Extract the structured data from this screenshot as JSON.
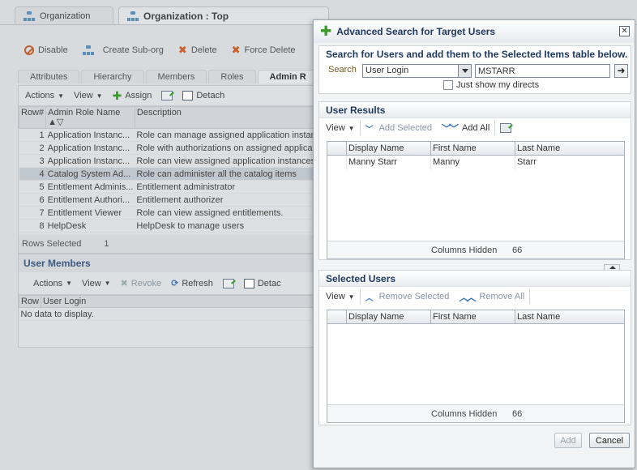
{
  "background": {
    "tabs": [
      {
        "label": "Organization"
      },
      {
        "label": "Organization : Top"
      }
    ],
    "toolbar": {
      "disable": "Disable",
      "create_suborg": "Create Sub-org",
      "delete": "Delete",
      "force_delete": "Force Delete"
    },
    "subtabs": [
      "Attributes",
      "Hierarchy",
      "Members",
      "Roles",
      "Admin R"
    ],
    "admin_roles": {
      "actions": "Actions",
      "view": "View",
      "assign": "Assign",
      "detach": "Detach",
      "columns": {
        "row": "Row#",
        "name": "Admin Role Name",
        "description": "Description"
      },
      "rows": [
        {
          "num": "1",
          "name": "Application Instanc...",
          "desc": "Role can manage assigned application instance"
        },
        {
          "num": "2",
          "name": "Application Instanc...",
          "desc": "Role with authorizations on assigned applicatio"
        },
        {
          "num": "3",
          "name": "Application Instanc...",
          "desc": "Role can view assigned application instances."
        },
        {
          "num": "4",
          "name": "Catalog System Ad...",
          "desc": "Role can administer all the catalog items"
        },
        {
          "num": "5",
          "name": "Entitlement Adminis...",
          "desc": "Entitlement administrator"
        },
        {
          "num": "6",
          "name": "Entitlement Authori...",
          "desc": "Entitlement authorizer"
        },
        {
          "num": "7",
          "name": "Entitlement Viewer",
          "desc": "Role can view assigned entitlements."
        },
        {
          "num": "8",
          "name": "HelpDesk",
          "desc": "HelpDesk to manage users"
        }
      ],
      "rows_selected_label": "Rows Selected",
      "rows_selected_value": "1"
    },
    "user_members": {
      "title": "User Members",
      "actions": "Actions",
      "view": "View",
      "revoke": "Revoke",
      "refresh": "Refresh",
      "detach": "Detac",
      "columns": {
        "row": "Row",
        "login": "User Login"
      },
      "empty": "No data to display."
    }
  },
  "dialog": {
    "title": "Advanced Search for Target Users",
    "search_heading": "Search for Users and add them to the Selected Items table below.",
    "search_label": "Search",
    "search_field": "User Login",
    "search_value": "MSTARR",
    "just_directs": "Just show my directs",
    "user_results": {
      "title": "User Results",
      "view": "View",
      "add_selected": "Add Selected",
      "add_all": "Add All",
      "columns": [
        "Display Name",
        "First Name",
        "Last Name"
      ],
      "rows": [
        {
          "display": "Manny Starr",
          "first": "Manny",
          "last": "Starr"
        }
      ],
      "columns_hidden_label": "Columns Hidden",
      "columns_hidden_value": "66"
    },
    "selected_users": {
      "title": "Selected Users",
      "view": "View",
      "remove_selected": "Remove Selected",
      "remove_all": "Remove All",
      "columns": [
        "Display Name",
        "First Name",
        "Last Name"
      ],
      "columns_hidden_label": "Columns Hidden",
      "columns_hidden_value": "66"
    },
    "add_button": "Add",
    "cancel_button": "Cancel"
  }
}
